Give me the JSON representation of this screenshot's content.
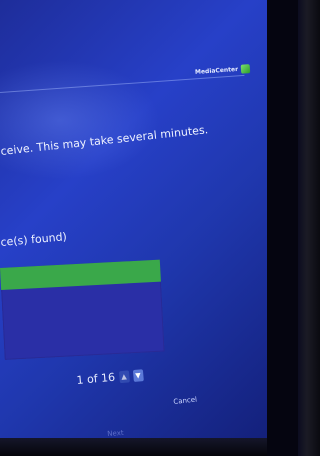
{
  "header": {
    "brand_label": "MediaCenter"
  },
  "main": {
    "instruction_text": "ceive. This may take several minutes.",
    "found_text": "ce(s) found)"
  },
  "pager": {
    "page_text": "1 of 16"
  },
  "buttons": {
    "next_label": "Next",
    "cancel_label": "Cancel"
  },
  "colors": {
    "background": "#2740c8",
    "list_selected": "#3aa84a",
    "bezel": "#0b0c20"
  },
  "icons": {
    "brand": "media-center-logo-icon",
    "page_up": "chevron-up-icon",
    "page_down": "chevron-down-icon"
  }
}
